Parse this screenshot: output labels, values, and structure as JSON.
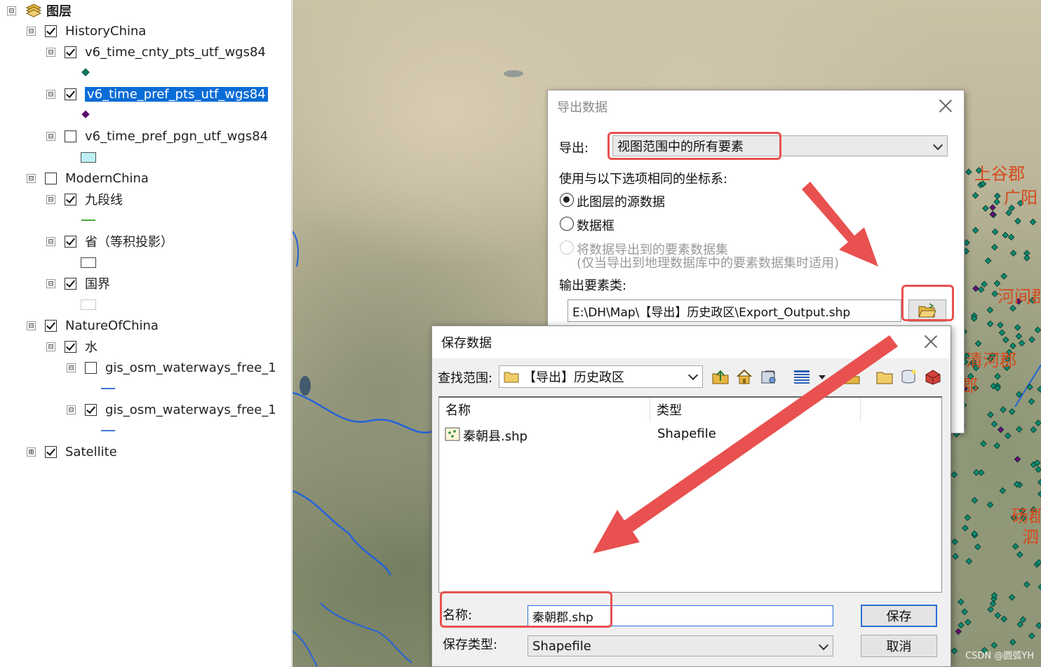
{
  "toc": {
    "root_label": "图层",
    "groups": [
      {
        "label": "HistoryChina"
      },
      {
        "label": "v6_time_cnty_pts_utf_wgs84"
      },
      {
        "label": "v6_time_pref_pts_utf_wgs84"
      },
      {
        "label": "v6_time_pref_pgn_utf_wgs84"
      },
      {
        "label": "ModernChina"
      },
      {
        "label": "九段线"
      },
      {
        "label": "省（等积投影）"
      },
      {
        "label": "国界"
      },
      {
        "label": "NatureOfChina"
      },
      {
        "label": "水"
      },
      {
        "label": "gis_osm_waterways_free_1"
      },
      {
        "label": "gis_osm_waterways_free_1"
      },
      {
        "label": "Satellite"
      }
    ],
    "expand_minus": "⊟",
    "expand_plus": "⊞"
  },
  "map": {
    "labels": [
      "上谷郡",
      "广阳",
      "河间郡",
      "清河郡",
      "郡",
      "砀郡",
      "泗"
    ]
  },
  "export_dialog": {
    "title": "导出数据",
    "export_label": "导出:",
    "export_value": "视图范围中的所有要素",
    "coord_label": "使用与以下选项相同的坐标系:",
    "radio_source": "此图层的源数据",
    "radio_frame": "数据框",
    "radio_dataset": "将数据导出到的要素数据集",
    "radio_dataset_note": "(仅当导出到地理数据库中的要素数据集时适用)",
    "output_label": "输出要素类:",
    "output_path": "E:\\DH\\Map\\【导出】历史政区\\Export_Output.shp"
  },
  "save_dialog": {
    "title": "保存数据",
    "lookin_label": "查找范围:",
    "lookin_value": "【导出】历史政区",
    "col_name": "名称",
    "col_type": "类型",
    "rows": [
      {
        "name": "秦朝县.shp",
        "type": "Shapefile"
      }
    ],
    "name_label": "名称:",
    "name_value": "秦朝郡.shp",
    "type_label": "保存类型:",
    "type_value": "Shapefile",
    "save_btn": "保存",
    "cancel_btn": "取消"
  },
  "watermark": "CSDN @圆弧YH",
  "colors": {
    "highlight": "#e8514f",
    "selection": "#0a6cd6",
    "map_label": "#d44b1e"
  }
}
